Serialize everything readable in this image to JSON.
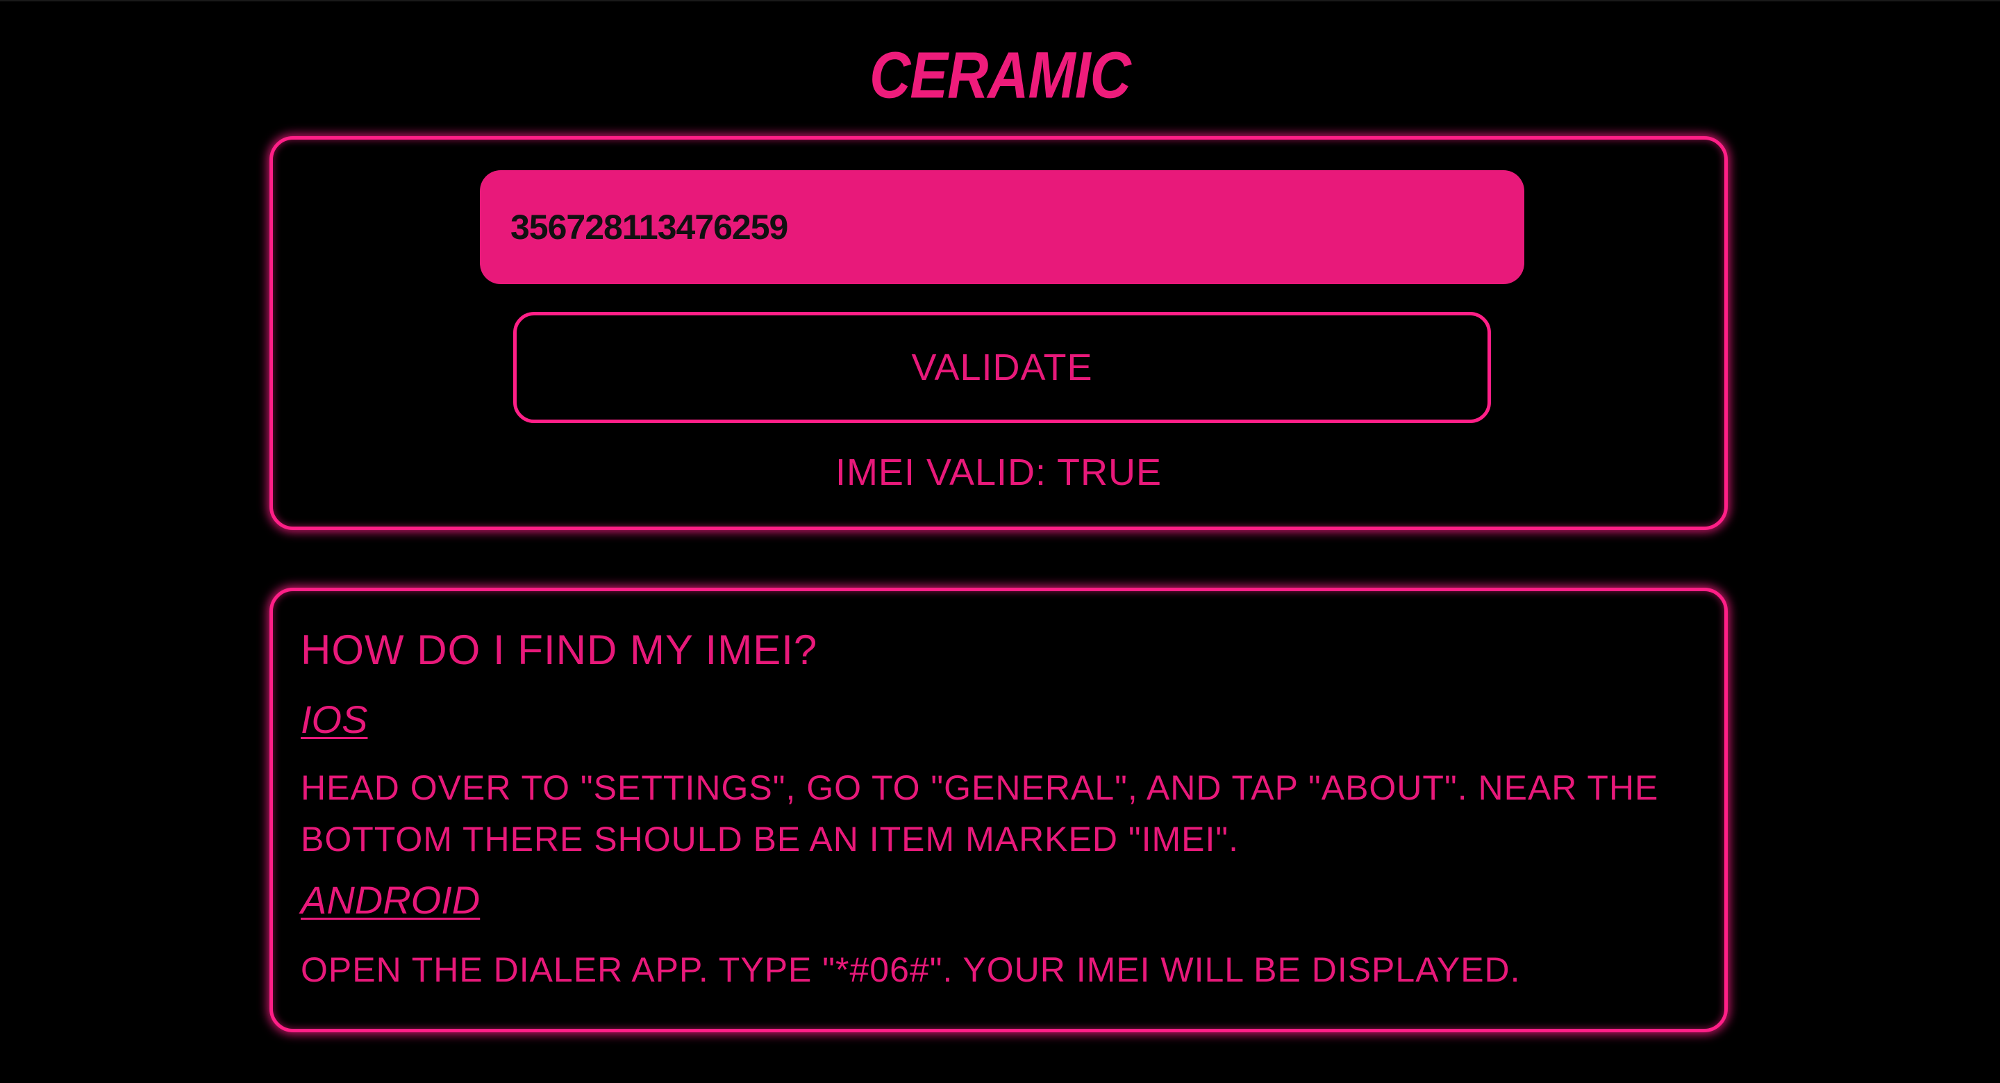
{
  "app": {
    "title": "CERAMIC"
  },
  "validator": {
    "imei_value": "356728113476259",
    "validate_label": "VALIDATE",
    "status": "IMEI VALID: TRUE"
  },
  "help": {
    "title": "HOW DO I FIND MY IMEI?",
    "ios": {
      "heading": "IOS",
      "text": "HEAD OVER TO \"SETTINGS\", GO TO \"GENERAL\", AND TAP \"ABOUT\". NEAR THE BOTTOM THERE SHOULD BE AN ITEM MARKED \"IMEI\"."
    },
    "android": {
      "heading": "ANDROID",
      "text": "OPEN THE DIALER APP. TYPE \"*#06#\". YOUR IMEI WILL BE DISPLAYED."
    }
  },
  "colors": {
    "accent": "#e8197a",
    "glow": "#ff1f87",
    "background": "#000000"
  }
}
